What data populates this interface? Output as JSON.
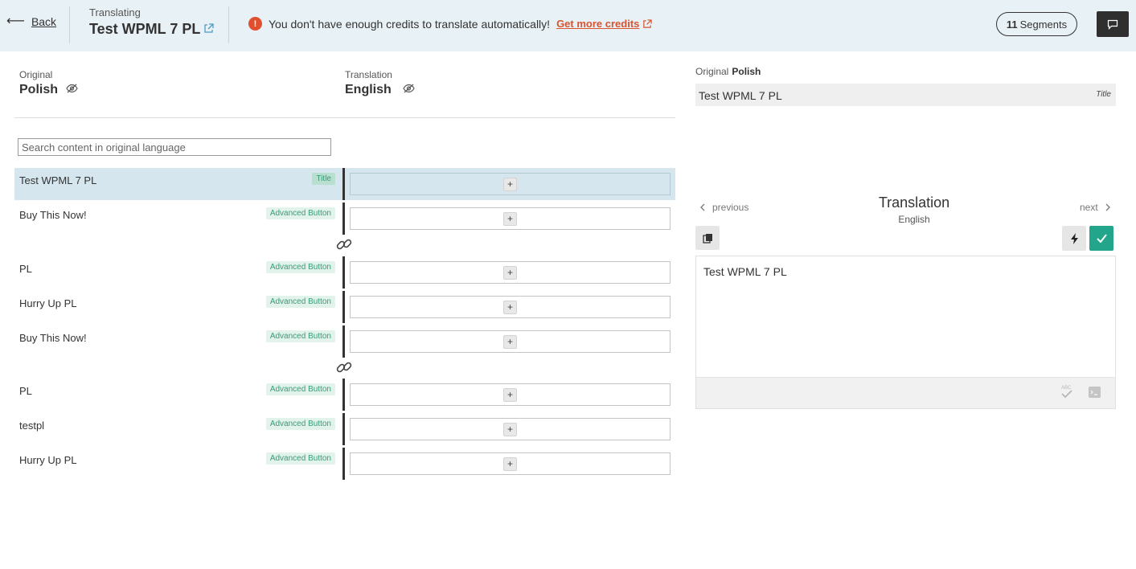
{
  "header": {
    "back_label": "Back",
    "translating_label": "Translating",
    "doc_title": "Test WPML 7 PL",
    "alert_text": "You don't have enough credits to translate automatically!",
    "alert_link": "Get more credits",
    "segments_count": "11",
    "segments_label": "Segments"
  },
  "columns": {
    "original_label": "Original",
    "original_lang": "Polish",
    "translation_label": "Translation",
    "translation_lang": "English"
  },
  "search": {
    "placeholder": "Search content in original language"
  },
  "rows": [
    {
      "text": "Test WPML 7 PL",
      "tag": "Title"
    },
    {
      "text": "Buy This Now!",
      "tag": "Advanced Button"
    },
    {
      "text": "PL",
      "tag": "Advanced Button"
    },
    {
      "text": "Hurry Up PL",
      "tag": "Advanced Button"
    },
    {
      "text": "Buy This Now!",
      "tag": "Advanced Button"
    },
    {
      "text": "PL",
      "tag": "Advanced Button"
    },
    {
      "text": "testpl",
      "tag": "Advanced Button"
    },
    {
      "text": "Hurry Up PL",
      "tag": "Advanced Button"
    }
  ],
  "row_action_symbol": "+",
  "panel": {
    "original_label": "Original",
    "original_lang": "Polish",
    "original_text": "Test WPML 7 PL",
    "original_tag": "Title",
    "prev_label": "previous",
    "next_label": "next",
    "translation_title": "Translation",
    "translation_lang": "English",
    "translation_text": "Test WPML 7 PL"
  },
  "colors": {
    "header_bg": "#e8f1f5",
    "active_row": "#d5e6ef",
    "accent_green": "#22a58a",
    "alert_orange": "#e0502e"
  },
  "icons": [
    "arrow-left-icon",
    "external-link-icon",
    "alert-icon",
    "comment-icon",
    "eye-slash-icon",
    "link-chain-icon",
    "plus-icon",
    "chevron-left-icon",
    "chevron-right-icon",
    "copy-icon",
    "bolt-icon",
    "check-icon",
    "spellcheck-icon",
    "code-icon"
  ]
}
